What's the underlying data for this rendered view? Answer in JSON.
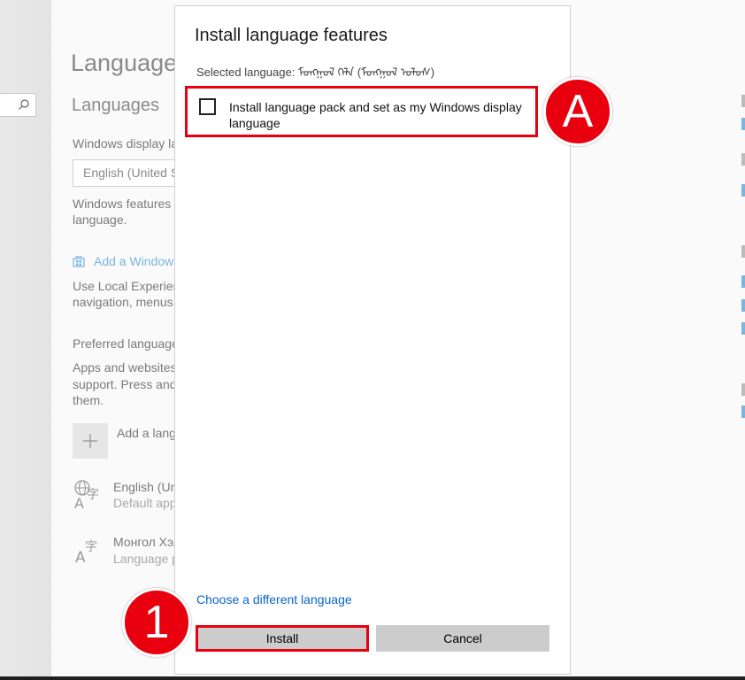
{
  "background": {
    "page_title": "Language",
    "section_heading": "Languages",
    "display_language_label": "Windows display la",
    "display_language_value": "English (United S",
    "features_text_1": "Windows features l",
    "features_text_2": "language.",
    "add_windows_link": "Add a Window",
    "local_experience_1": "Use Local Experien",
    "local_experience_2": "navigation, menus,",
    "preferred_label": "Preferred language",
    "apps_text_1": "Apps and websites",
    "apps_text_2": "support. Press and",
    "apps_text_3": "them.",
    "add_language_label": "Add a lang",
    "language_1_name": "English (Un",
    "language_1_sub": "Default app",
    "language_2_name": "Монгол Хэл",
    "language_2_sub": "Language p"
  },
  "dialog": {
    "title": "Install language features",
    "selected_language": "Selected language: ᠮᠣᠩᠭᠣᠯ ᠬᠡᠯᠡ (ᠮᠣᠩᠭᠣᠯ ᠤᠯᠤᠰ)",
    "option_label": "Install language pack and set as my Windows display language",
    "choose_link": "Choose a different language",
    "install_label": "Install",
    "cancel_label": "Cancel"
  },
  "callouts": {
    "a_label": "A",
    "one_label": "1"
  },
  "colors": {
    "highlight": "#e8000f",
    "link": "#0a64c8"
  }
}
